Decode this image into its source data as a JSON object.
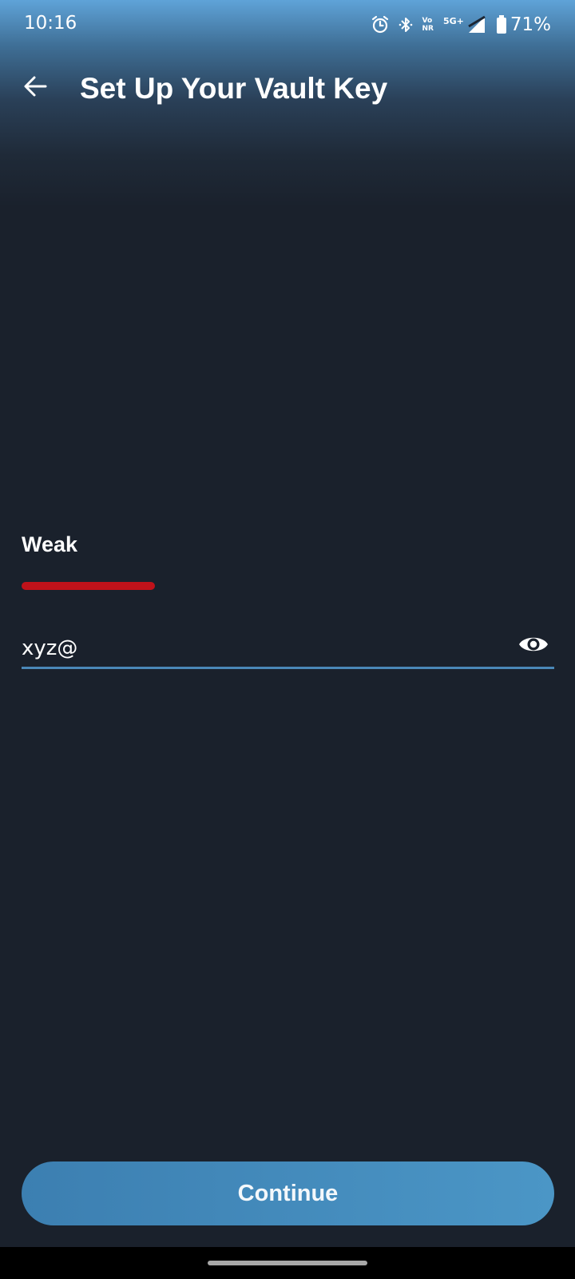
{
  "status_bar": {
    "time": "10:16",
    "vonr_top": "Vo",
    "vonr_bottom": "NR",
    "network": "5G+",
    "battery": "71%",
    "icons": [
      "alarm-icon",
      "bluetooth-icon",
      "vonr-wifi-icon",
      "signal-icon",
      "battery-icon"
    ]
  },
  "header": {
    "back_icon": "arrow-left-icon",
    "title": "Set Up Your Vault Key"
  },
  "strength": {
    "label": "Weak",
    "level": 0.25,
    "color": "#c0121a"
  },
  "password_field": {
    "value": "xyz@",
    "toggle_icon": "eye-icon"
  },
  "continue_button": {
    "label": "Continue"
  },
  "colors": {
    "background": "#1a212c",
    "accent": "#4a88b8",
    "button": "#3f88bb"
  }
}
